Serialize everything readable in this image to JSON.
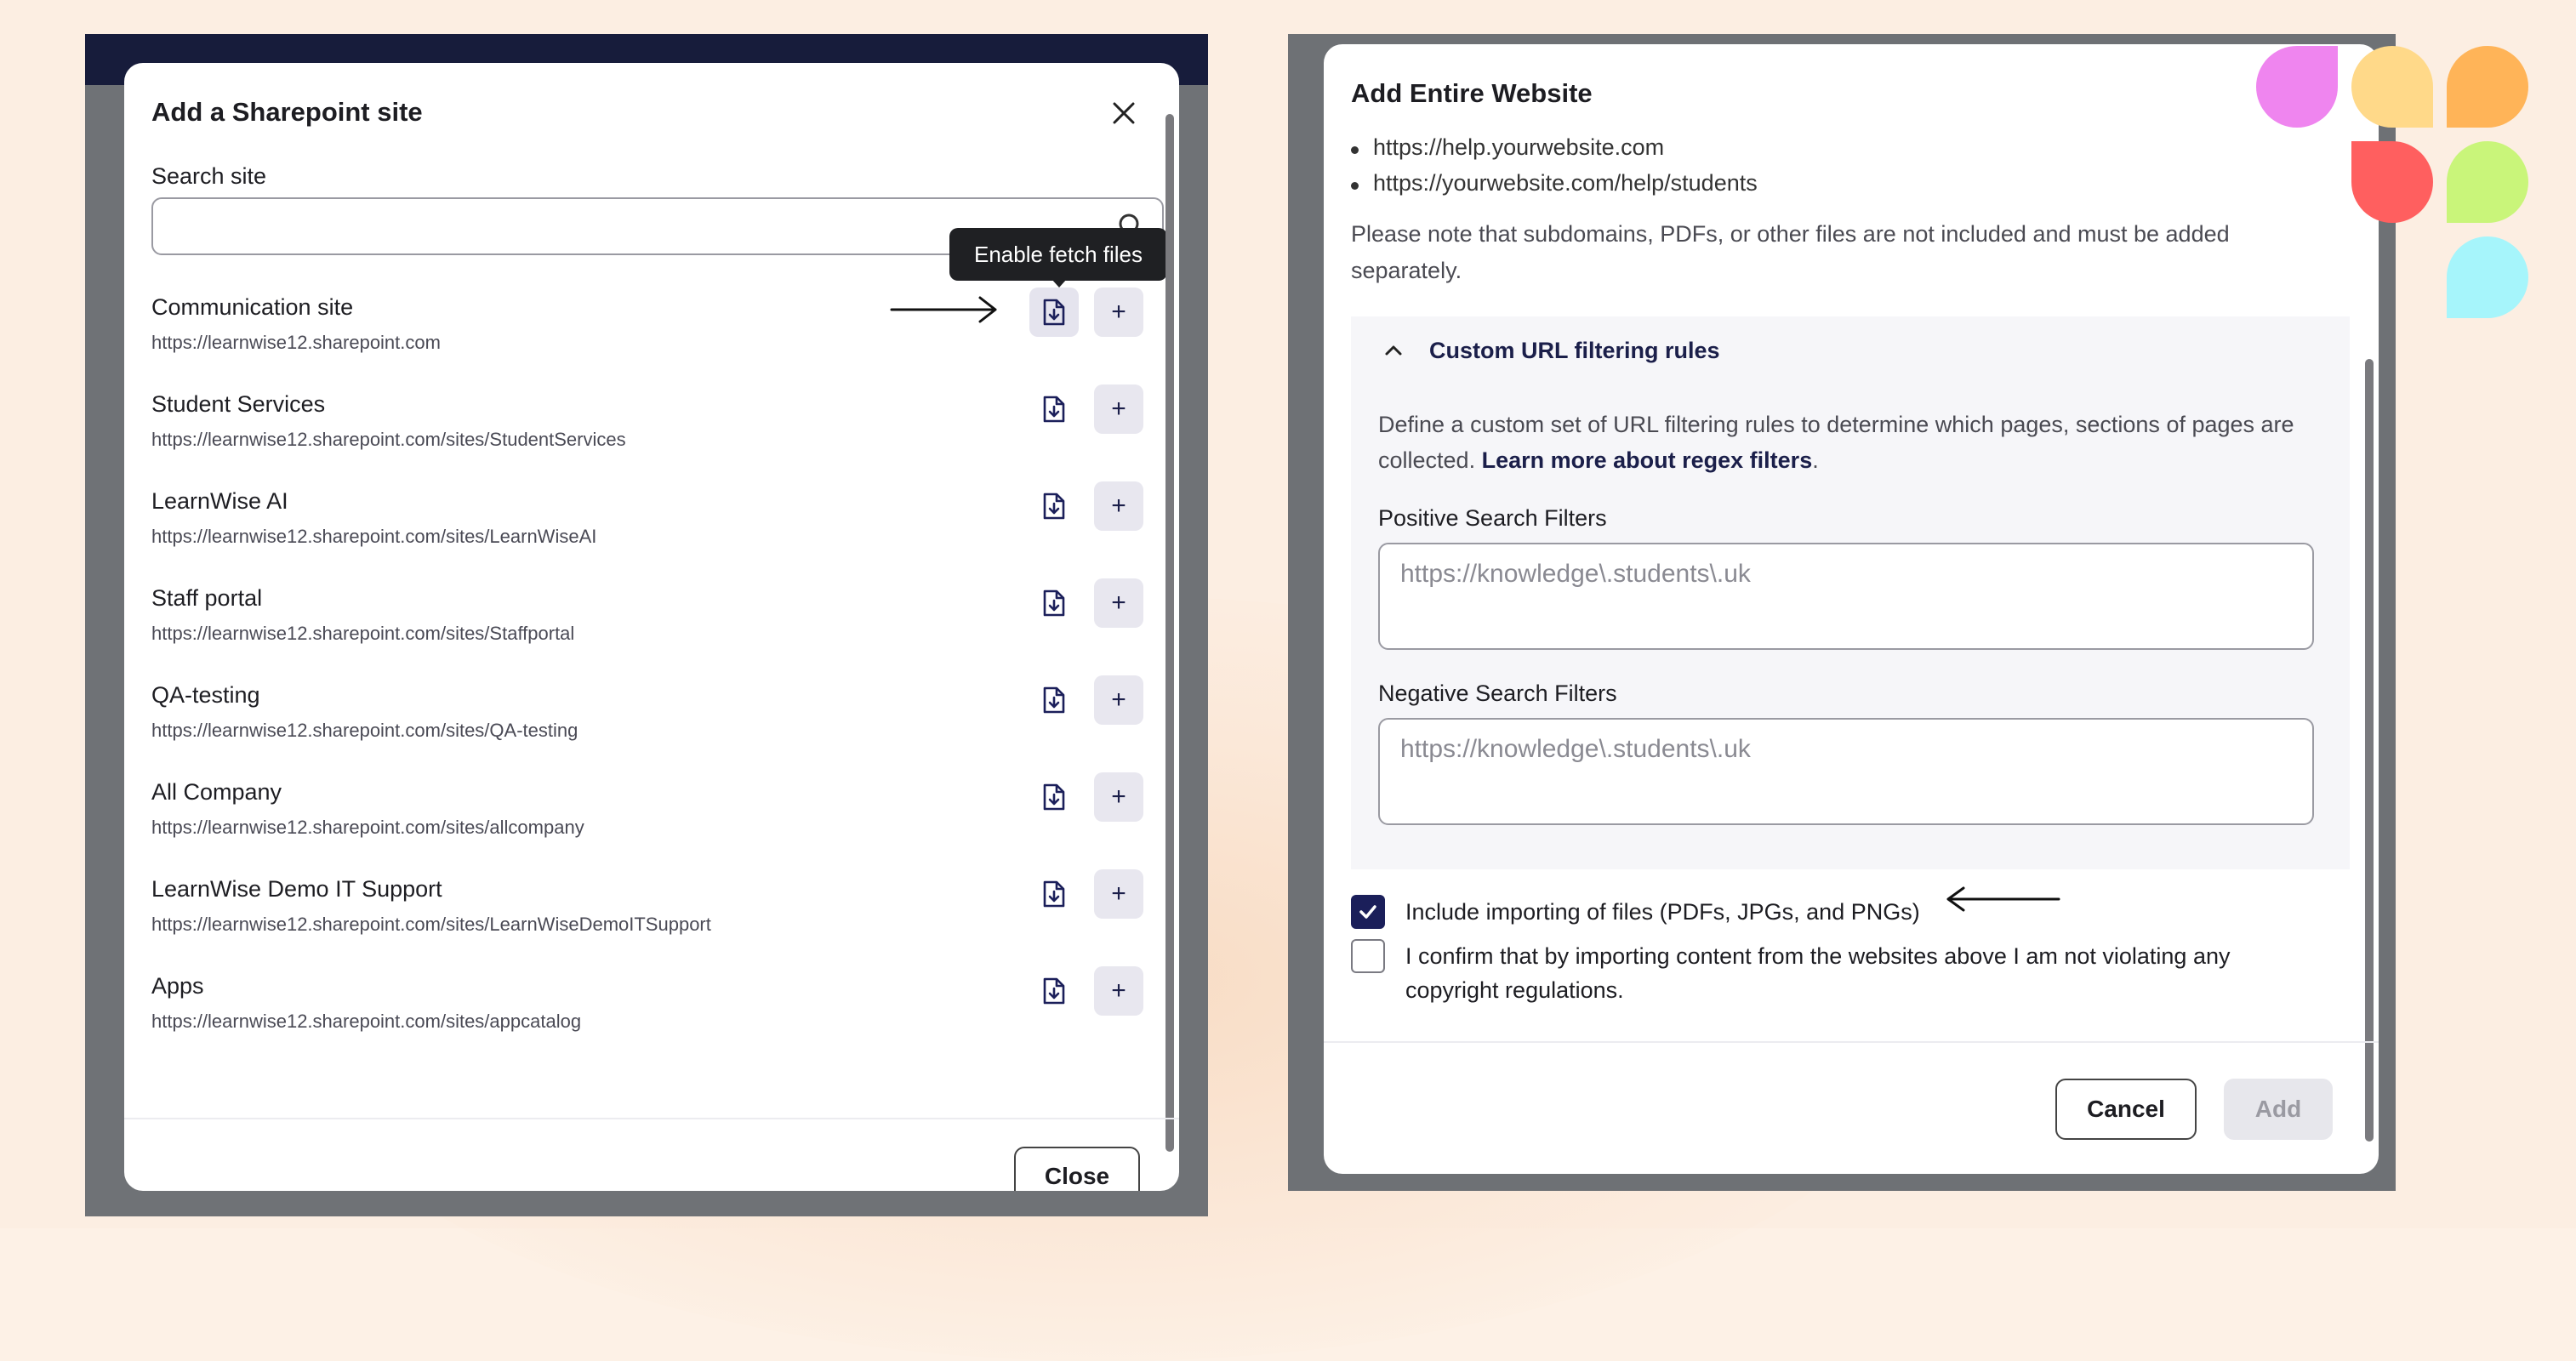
{
  "left_modal": {
    "title": "Add a Sharepoint site",
    "search_label": "Search site",
    "search_value": "",
    "tooltip": "Enable fetch files",
    "sites": [
      {
        "name": "Communication site",
        "url": "https://learnwise12.sharepoint.com"
      },
      {
        "name": "Student Services",
        "url": "https://learnwise12.sharepoint.com/sites/StudentServices"
      },
      {
        "name": "LearnWise AI",
        "url": "https://learnwise12.sharepoint.com/sites/LearnWiseAI"
      },
      {
        "name": "Staff portal",
        "url": "https://learnwise12.sharepoint.com/sites/Staffportal"
      },
      {
        "name": "QA-testing",
        "url": "https://learnwise12.sharepoint.com/sites/QA-testing"
      },
      {
        "name": "All Company",
        "url": "https://learnwise12.sharepoint.com/sites/allcompany"
      },
      {
        "name": "LearnWise Demo IT Support",
        "url": "https://learnwise12.sharepoint.com/sites/LearnWiseDemoITSupport"
      },
      {
        "name": "Apps",
        "url": "https://learnwise12.sharepoint.com/sites/appcatalog"
      }
    ],
    "add_symbol": "+",
    "close_label": "Close"
  },
  "right_modal": {
    "title": "Add Entire Website",
    "bullets": [
      "https://help.yourwebsite.com",
      "https://yourwebsite.com/help/students"
    ],
    "note": "Please note that subdomains, PDFs, or other files are not included and must be added separately.",
    "accordion": {
      "title": "Custom URL filtering rules",
      "description": "Define a custom set of URL filtering rules to determine which pages, sections of pages are collected.",
      "link": "Learn more about regex filters",
      "link_suffix": ".",
      "positive_label": "Positive Search Filters",
      "positive_placeholder": "https://knowledge\\.students\\.uk",
      "negative_label": "Negative Search Filters",
      "negative_placeholder": "https://knowledge\\.students\\.uk"
    },
    "include_files": {
      "label": "Include importing of files (PDFs, JPGs, and PNGs)",
      "checked": true
    },
    "confirm": {
      "label": "I confirm that by importing content from the websites above I am not violating any copyright regulations.",
      "checked": false
    },
    "cancel_label": "Cancel",
    "add_label": "Add"
  },
  "colors": {
    "background": "#fceee2",
    "primary_navy": "#1b1f5a",
    "logo_pink": "#ef85ef",
    "logo_yellow": "#ffd989",
    "logo_orange": "#ffb458",
    "logo_red": "#ff5f5f",
    "logo_green": "#c9f57a",
    "logo_cyan": "#a6f5fb"
  }
}
